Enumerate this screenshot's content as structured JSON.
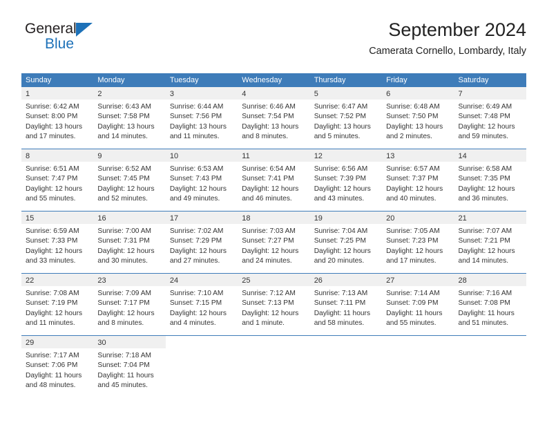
{
  "brand": {
    "name_dark": "General",
    "name_blue": "Blue",
    "accent_color": "#1d71b8"
  },
  "header": {
    "title": "September 2024",
    "subtitle": "Camerata Cornello, Lombardy, Italy"
  },
  "calendar": {
    "header_bg": "#3e7cb9",
    "daynum_bg": "#f0f0f0",
    "weekdays": [
      "Sunday",
      "Monday",
      "Tuesday",
      "Wednesday",
      "Thursday",
      "Friday",
      "Saturday"
    ],
    "weeks": [
      [
        {
          "day": "1",
          "sunrise": "Sunrise: 6:42 AM",
          "sunset": "Sunset: 8:00 PM",
          "daylight1": "Daylight: 13 hours",
          "daylight2": "and 17 minutes."
        },
        {
          "day": "2",
          "sunrise": "Sunrise: 6:43 AM",
          "sunset": "Sunset: 7:58 PM",
          "daylight1": "Daylight: 13 hours",
          "daylight2": "and 14 minutes."
        },
        {
          "day": "3",
          "sunrise": "Sunrise: 6:44 AM",
          "sunset": "Sunset: 7:56 PM",
          "daylight1": "Daylight: 13 hours",
          "daylight2": "and 11 minutes."
        },
        {
          "day": "4",
          "sunrise": "Sunrise: 6:46 AM",
          "sunset": "Sunset: 7:54 PM",
          "daylight1": "Daylight: 13 hours",
          "daylight2": "and 8 minutes."
        },
        {
          "day": "5",
          "sunrise": "Sunrise: 6:47 AM",
          "sunset": "Sunset: 7:52 PM",
          "daylight1": "Daylight: 13 hours",
          "daylight2": "and 5 minutes."
        },
        {
          "day": "6",
          "sunrise": "Sunrise: 6:48 AM",
          "sunset": "Sunset: 7:50 PM",
          "daylight1": "Daylight: 13 hours",
          "daylight2": "and 2 minutes."
        },
        {
          "day": "7",
          "sunrise": "Sunrise: 6:49 AM",
          "sunset": "Sunset: 7:48 PM",
          "daylight1": "Daylight: 12 hours",
          "daylight2": "and 59 minutes."
        }
      ],
      [
        {
          "day": "8",
          "sunrise": "Sunrise: 6:51 AM",
          "sunset": "Sunset: 7:47 PM",
          "daylight1": "Daylight: 12 hours",
          "daylight2": "and 55 minutes."
        },
        {
          "day": "9",
          "sunrise": "Sunrise: 6:52 AM",
          "sunset": "Sunset: 7:45 PM",
          "daylight1": "Daylight: 12 hours",
          "daylight2": "and 52 minutes."
        },
        {
          "day": "10",
          "sunrise": "Sunrise: 6:53 AM",
          "sunset": "Sunset: 7:43 PM",
          "daylight1": "Daylight: 12 hours",
          "daylight2": "and 49 minutes."
        },
        {
          "day": "11",
          "sunrise": "Sunrise: 6:54 AM",
          "sunset": "Sunset: 7:41 PM",
          "daylight1": "Daylight: 12 hours",
          "daylight2": "and 46 minutes."
        },
        {
          "day": "12",
          "sunrise": "Sunrise: 6:56 AM",
          "sunset": "Sunset: 7:39 PM",
          "daylight1": "Daylight: 12 hours",
          "daylight2": "and 43 minutes."
        },
        {
          "day": "13",
          "sunrise": "Sunrise: 6:57 AM",
          "sunset": "Sunset: 7:37 PM",
          "daylight1": "Daylight: 12 hours",
          "daylight2": "and 40 minutes."
        },
        {
          "day": "14",
          "sunrise": "Sunrise: 6:58 AM",
          "sunset": "Sunset: 7:35 PM",
          "daylight1": "Daylight: 12 hours",
          "daylight2": "and 36 minutes."
        }
      ],
      [
        {
          "day": "15",
          "sunrise": "Sunrise: 6:59 AM",
          "sunset": "Sunset: 7:33 PM",
          "daylight1": "Daylight: 12 hours",
          "daylight2": "and 33 minutes."
        },
        {
          "day": "16",
          "sunrise": "Sunrise: 7:00 AM",
          "sunset": "Sunset: 7:31 PM",
          "daylight1": "Daylight: 12 hours",
          "daylight2": "and 30 minutes."
        },
        {
          "day": "17",
          "sunrise": "Sunrise: 7:02 AM",
          "sunset": "Sunset: 7:29 PM",
          "daylight1": "Daylight: 12 hours",
          "daylight2": "and 27 minutes."
        },
        {
          "day": "18",
          "sunrise": "Sunrise: 7:03 AM",
          "sunset": "Sunset: 7:27 PM",
          "daylight1": "Daylight: 12 hours",
          "daylight2": "and 24 minutes."
        },
        {
          "day": "19",
          "sunrise": "Sunrise: 7:04 AM",
          "sunset": "Sunset: 7:25 PM",
          "daylight1": "Daylight: 12 hours",
          "daylight2": "and 20 minutes."
        },
        {
          "day": "20",
          "sunrise": "Sunrise: 7:05 AM",
          "sunset": "Sunset: 7:23 PM",
          "daylight1": "Daylight: 12 hours",
          "daylight2": "and 17 minutes."
        },
        {
          "day": "21",
          "sunrise": "Sunrise: 7:07 AM",
          "sunset": "Sunset: 7:21 PM",
          "daylight1": "Daylight: 12 hours",
          "daylight2": "and 14 minutes."
        }
      ],
      [
        {
          "day": "22",
          "sunrise": "Sunrise: 7:08 AM",
          "sunset": "Sunset: 7:19 PM",
          "daylight1": "Daylight: 12 hours",
          "daylight2": "and 11 minutes."
        },
        {
          "day": "23",
          "sunrise": "Sunrise: 7:09 AM",
          "sunset": "Sunset: 7:17 PM",
          "daylight1": "Daylight: 12 hours",
          "daylight2": "and 8 minutes."
        },
        {
          "day": "24",
          "sunrise": "Sunrise: 7:10 AM",
          "sunset": "Sunset: 7:15 PM",
          "daylight1": "Daylight: 12 hours",
          "daylight2": "and 4 minutes."
        },
        {
          "day": "25",
          "sunrise": "Sunrise: 7:12 AM",
          "sunset": "Sunset: 7:13 PM",
          "daylight1": "Daylight: 12 hours",
          "daylight2": "and 1 minute."
        },
        {
          "day": "26",
          "sunrise": "Sunrise: 7:13 AM",
          "sunset": "Sunset: 7:11 PM",
          "daylight1": "Daylight: 11 hours",
          "daylight2": "and 58 minutes."
        },
        {
          "day": "27",
          "sunrise": "Sunrise: 7:14 AM",
          "sunset": "Sunset: 7:09 PM",
          "daylight1": "Daylight: 11 hours",
          "daylight2": "and 55 minutes."
        },
        {
          "day": "28",
          "sunrise": "Sunrise: 7:16 AM",
          "sunset": "Sunset: 7:08 PM",
          "daylight1": "Daylight: 11 hours",
          "daylight2": "and 51 minutes."
        }
      ],
      [
        {
          "day": "29",
          "sunrise": "Sunrise: 7:17 AM",
          "sunset": "Sunset: 7:06 PM",
          "daylight1": "Daylight: 11 hours",
          "daylight2": "and 48 minutes."
        },
        {
          "day": "30",
          "sunrise": "Sunrise: 7:18 AM",
          "sunset": "Sunset: 7:04 PM",
          "daylight1": "Daylight: 11 hours",
          "daylight2": "and 45 minutes."
        },
        {
          "day": "",
          "sunrise": "",
          "sunset": "",
          "daylight1": "",
          "daylight2": ""
        },
        {
          "day": "",
          "sunrise": "",
          "sunset": "",
          "daylight1": "",
          "daylight2": ""
        },
        {
          "day": "",
          "sunrise": "",
          "sunset": "",
          "daylight1": "",
          "daylight2": ""
        },
        {
          "day": "",
          "sunrise": "",
          "sunset": "",
          "daylight1": "",
          "daylight2": ""
        },
        {
          "day": "",
          "sunrise": "",
          "sunset": "",
          "daylight1": "",
          "daylight2": ""
        }
      ]
    ]
  }
}
